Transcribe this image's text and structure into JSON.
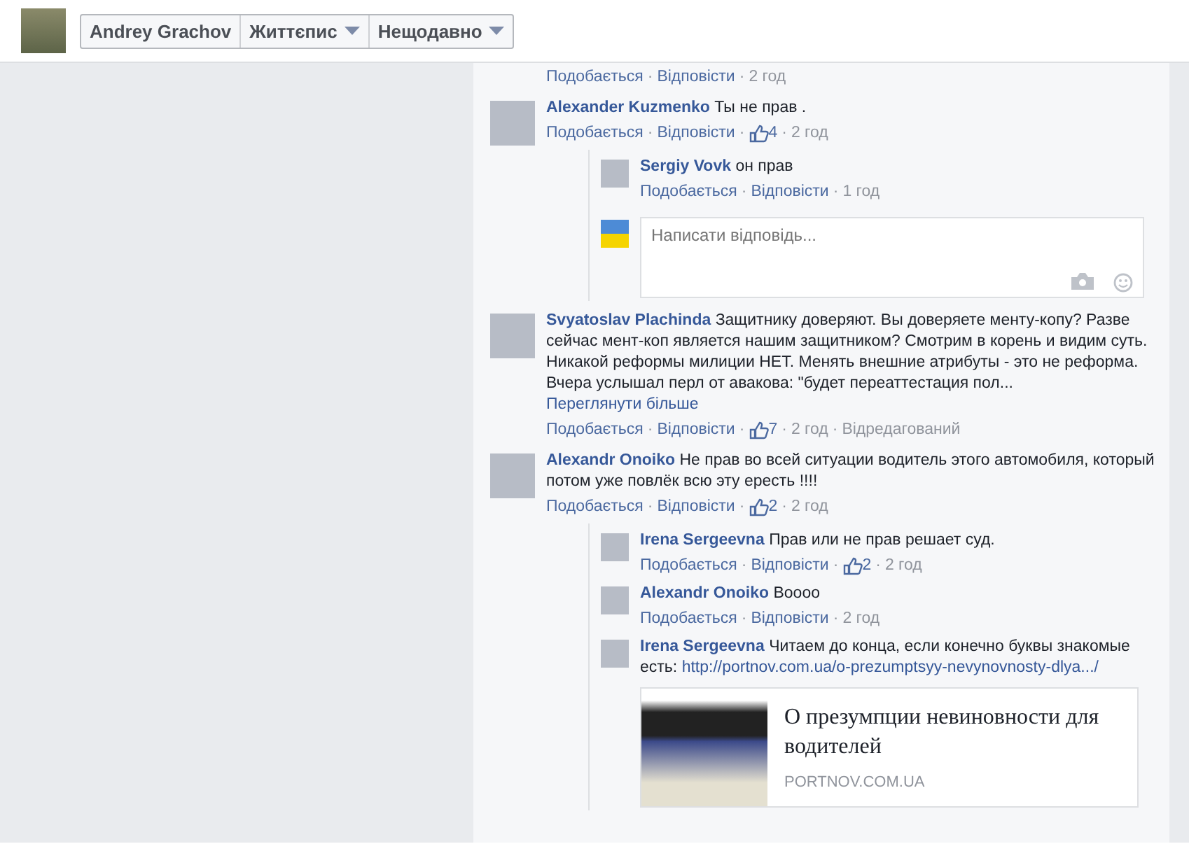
{
  "header": {
    "buttons": [
      {
        "label": "Andrey Grachov",
        "dropdown": false
      },
      {
        "label": "Життєпис",
        "dropdown": true
      },
      {
        "label": "Нещодавно",
        "dropdown": true
      }
    ]
  },
  "separator": "·",
  "clipped_actions": {
    "like": "Подобається",
    "reply": "Відповісти",
    "time": "2 год"
  },
  "comments": [
    {
      "author": "Alexander Kuzmenko",
      "text": "Ты не прав .",
      "like": "Подобається",
      "reply": "Відповісти",
      "likes": "4",
      "time": "2 год",
      "children": [
        {
          "author": "Sergiy Vovk",
          "text": "он прав",
          "like": "Подобається",
          "reply": "Відповісти",
          "time": "1 год"
        }
      ],
      "reply_box": {
        "placeholder": "Написати відповідь..."
      }
    },
    {
      "author": "Svyatoslav Plachinda",
      "text": "Защитнику доверяют. Вы доверяете менту-копу? Разве сейчас мент-коп является нашим защитником? Смотрим в корень и видим суть. Никакой реформы милиции НЕТ. Менять внешние атрибуты - это не реформа. Вчера услышал перл от авакова: \"будет переаттестация пол...",
      "more": "Переглянути більше",
      "like": "Подобається",
      "reply": "Відповісти",
      "likes": "7",
      "time": "2 год",
      "edited": "Відредагований"
    },
    {
      "author": "Alexandr Onoiko",
      "text": "Не прав во всей ситуации водитель этого автомобиля, который потом уже повлёк всю эту ересть !!!!",
      "like": "Подобається",
      "reply": "Відповісти",
      "likes": "2",
      "time": "2 год",
      "children": [
        {
          "author": "Irena Sergeevna",
          "text": "Прав или не прав решает суд.",
          "like": "Подобається",
          "reply": "Відповісти",
          "likes": "2",
          "time": "2 год"
        },
        {
          "author": "Alexandr Onoiko",
          "text": "Boooo",
          "like": "Подобається",
          "reply": "Відповісти",
          "time": "2 год"
        },
        {
          "author": "Irena Sergeevna",
          "text": "Читаем до конца, если конечно буквы знакомые есть:",
          "link": "http://portnov.com.ua/o-prezumptsyy-nevynovnosty-dlya.../",
          "preview": {
            "title": "О презумпции невиновности для водителей",
            "domain": "PORTNOV.COM.UA"
          }
        }
      ]
    }
  ]
}
